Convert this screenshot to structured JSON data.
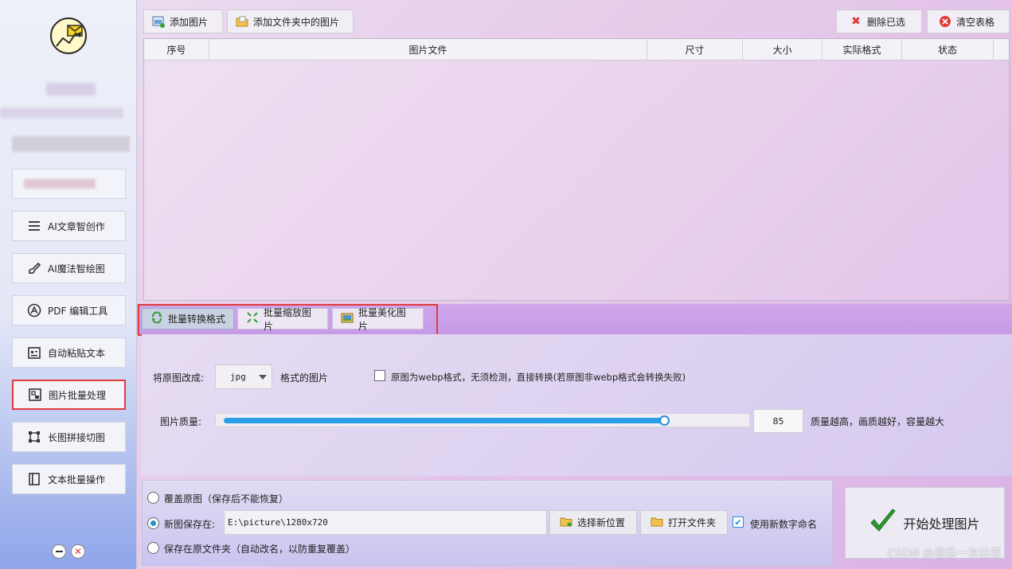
{
  "sidebar": {
    "items": [
      {
        "label": "AI文章智创作",
        "icon": "list-icon"
      },
      {
        "label": "AI魔法智绘图",
        "icon": "brush-icon"
      },
      {
        "label": "PDF 编辑工具",
        "icon": "pdf-icon"
      },
      {
        "label": "自动粘贴文本",
        "icon": "clipboard-icon"
      },
      {
        "label": "图片批量处理",
        "icon": "image-icon",
        "active": true
      },
      {
        "label": "长图拼接切图",
        "icon": "crop-icon"
      },
      {
        "label": "文本批量操作",
        "icon": "document-icon"
      }
    ]
  },
  "toolbar": {
    "add_image": "添加图片",
    "add_folder": "添加文件夹中的图片",
    "delete_selected": "删除已选",
    "clear_table": "清空表格"
  },
  "table": {
    "columns": [
      "序号",
      "图片文件",
      "尺寸",
      "大小",
      "实际格式",
      "状态"
    ]
  },
  "tabs": [
    {
      "label": "批量转换格式",
      "active": true
    },
    {
      "label": "批量缩放图片",
      "active": false
    },
    {
      "label": "批量美化图片",
      "active": false
    }
  ],
  "convert": {
    "change_to_label": "将原图改成:",
    "format_value": "jpg",
    "format_suffix": "格式的图片",
    "webp_option": "原图为webp格式，无须检测，直接转换(若原图非webp格式会转换失败)",
    "webp_checked": false,
    "quality_label": "图片质量:",
    "quality_value": "85",
    "quality_fraction": 0.85,
    "quality_hint": "质量越高，画质越好，容量越大"
  },
  "save": {
    "overwrite_label": "覆盖原图（保存后不能恢复）",
    "new_location_label": "新图保存在:",
    "path_value": "E:\\picture\\1280x720",
    "choose_location": "选择新位置",
    "open_folder": "打开文件夹",
    "use_number_name": "使用新数字命名",
    "use_number_checked": true,
    "original_folder_label": "保存在原文件夹（自动改名，以防重复覆盖）",
    "selected": "new_location"
  },
  "start_button": "开始处理图片",
  "watermark": "CSDN @最后一次日落",
  "colors": {
    "accent_blue": "#2aa0e6",
    "highlight_red": "#e23b3b",
    "tab_strip": "#c69be6",
    "check_green": "#2e9b2e"
  }
}
